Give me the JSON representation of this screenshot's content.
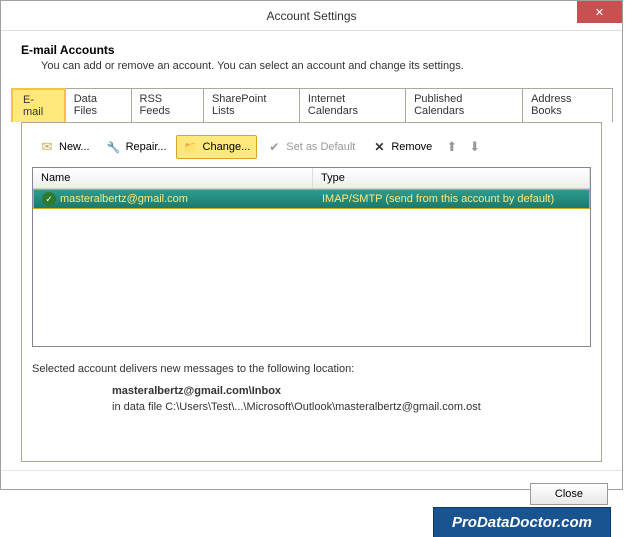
{
  "window": {
    "title": "Account Settings",
    "close_x": "✕"
  },
  "header": {
    "title": "E-mail Accounts",
    "description": "You can add or remove an account. You can select an account and change its settings."
  },
  "tabs": [
    {
      "label": "E-mail",
      "active": true
    },
    {
      "label": "Data Files",
      "active": false
    },
    {
      "label": "RSS Feeds",
      "active": false
    },
    {
      "label": "SharePoint Lists",
      "active": false
    },
    {
      "label": "Internet Calendars",
      "active": false
    },
    {
      "label": "Published Calendars",
      "active": false
    },
    {
      "label": "Address Books",
      "active": false
    }
  ],
  "toolbar": {
    "new_label": "New...",
    "repair_label": "Repair...",
    "change_label": "Change...",
    "default_label": "Set as Default",
    "remove_label": "Remove"
  },
  "table": {
    "col_name": "Name",
    "col_type": "Type",
    "rows": [
      {
        "name": "masteralbertz@gmail.com",
        "type": "IMAP/SMTP (send from this account by default)"
      }
    ]
  },
  "delivery": {
    "label": "Selected account delivers new messages to the following location:",
    "location": "masteralbertz@gmail.com\\Inbox",
    "datafile": "in data file C:\\Users\\Test\\...\\Microsoft\\Outlook\\masteralbertz@gmail.com.ost"
  },
  "footer": {
    "close_label": "Close"
  },
  "watermark": "ProDataDoctor.com"
}
